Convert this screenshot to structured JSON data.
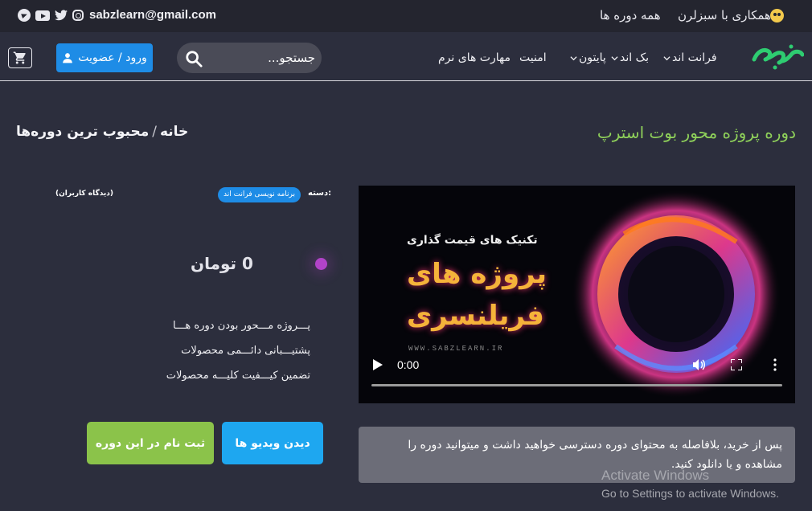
{
  "topbar": {
    "email": "sabzlearn@gmail.com",
    "social_icons": [
      "instagram-icon",
      "twitter-icon",
      "youtube-icon",
      "telegram-icon"
    ],
    "links": {
      "all_courses": "همه دوره ها",
      "cooperate": "همکاری با سبزلرن"
    }
  },
  "nav": {
    "login_label": "ورود / عضویت",
    "search_placeholder": "جستجو...",
    "menu": {
      "front": "فرانت اند",
      "back": "بک اند",
      "python": "پایتون",
      "security": "امنیت",
      "soft_skills": "مهارت های نرم"
    },
    "logo_text": "سبزلرن"
  },
  "page": {
    "course_title": "دوره پروژه محور بوت استرپ",
    "breadcrumb": {
      "home": "خانه",
      "separator": "/",
      "current": "محبوب ترین دوره‌ها"
    }
  },
  "video": {
    "time": "0:00",
    "art": {
      "subtitle": "تکنیک های قیمت گذاری",
      "line1": "پروژه های",
      "line2": "فریلنسری",
      "site": "WWW.SABZLEARN.IR"
    }
  },
  "notice": "پس از خرید، بلافاصله به محتوای دوره دسترسی خواهید داشت و میتوانید دوره را مشاهده و یا دانلود کنید.",
  "info": {
    "category_label": "دسته:",
    "category_value": "برنامه نویسی فرانت اند",
    "reviews": "(دیدگاه کاربران)",
    "price": "0 تومان",
    "features": [
      "پـــروژه مـــحور بودن دوره هـــا",
      "پشتیـــبانی دائـــمی محصولات",
      "تضمین کیـــفیت کلیـــه محصولات"
    ]
  },
  "buttons": {
    "videos": "دیدن ویدیو ها",
    "enroll": "ثبت نام در این دوره"
  },
  "watermark": {
    "line1": "Activate Windows",
    "line2": "Go to Settings to activate Windows."
  },
  "colors": {
    "background": "#2c2e3d",
    "accent_green": "#8fd15a",
    "accent_blue": "#1e8ce6",
    "enroll_green": "#8bc34a"
  }
}
